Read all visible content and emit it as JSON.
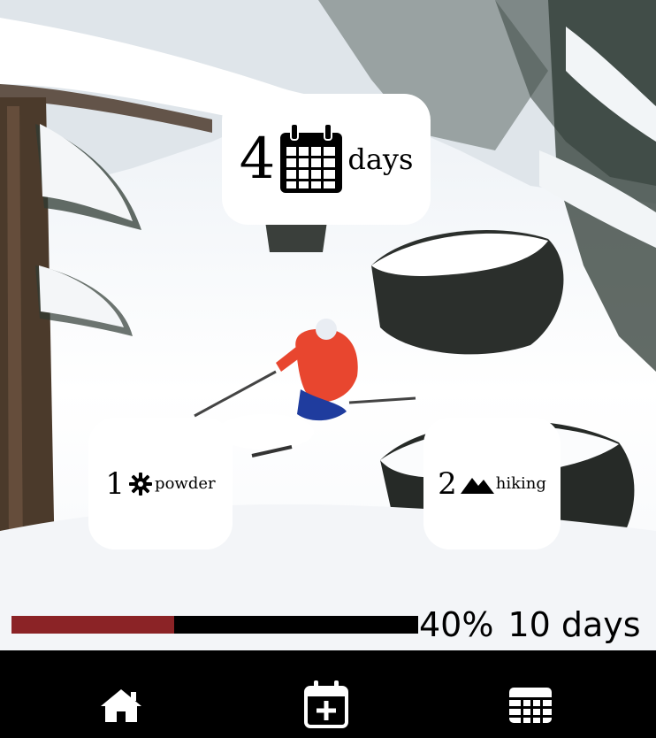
{
  "stats": {
    "days": {
      "value": "4",
      "label": "days",
      "icon": "calendar-icon"
    },
    "powder": {
      "value": "1",
      "label": "powder",
      "icon": "snowflake-icon"
    },
    "hiking": {
      "value": "2",
      "label": "hiking",
      "icon": "mountain-icon"
    }
  },
  "progress": {
    "percent": 40,
    "percent_label": "40%",
    "goal_label": "10 days",
    "fill_color": "#8b2326",
    "track_color": "#000000"
  },
  "nav": {
    "items": [
      {
        "icon": "home-icon"
      },
      {
        "icon": "calendar-add-icon"
      },
      {
        "icon": "grid-icon"
      }
    ],
    "background": "#000000"
  }
}
